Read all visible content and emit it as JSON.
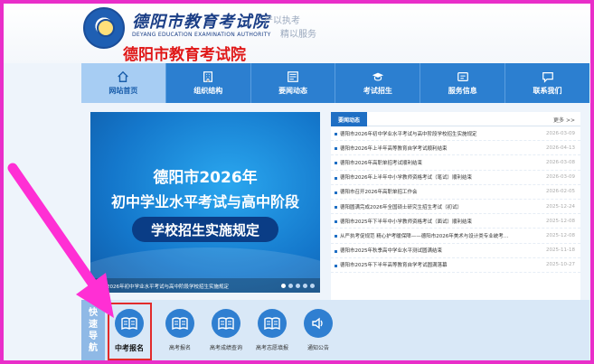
{
  "header": {
    "logo_cn": "德阳市教育考试院",
    "logo_en": "DEYANG EDUCATION EXAMINATION AUTHORITY",
    "slogan_line1": "严以执考",
    "slogan_line2": "精以服务",
    "title": "德阳市教育考试院"
  },
  "nav": [
    {
      "label": "网站首页",
      "icon": "home-icon"
    },
    {
      "label": "组织结构",
      "icon": "building-icon"
    },
    {
      "label": "要闻动态",
      "icon": "news-icon"
    },
    {
      "label": "考试招生",
      "icon": "graduation-cap-icon"
    },
    {
      "label": "服务信息",
      "icon": "service-icon"
    },
    {
      "label": "联系我们",
      "icon": "chat-icon"
    }
  ],
  "banner": {
    "line1": "德阳市2026年",
    "line2": "初中学业水平考试与高中阶段",
    "line3": "学校招生实施规定",
    "caption": "2026年初中学业水平考试与高中阶段学校招生实施规定",
    "slides": 5,
    "active_slide": 1
  },
  "news": {
    "tab": "要闻动态",
    "more": "更多 >>",
    "items": [
      {
        "title": "德阳市2026年初中学业水平考试与高中阶段学校招生实施规定",
        "date": "2026-03-09"
      },
      {
        "title": "德阳市2026年上半年高等教育自学考试顺利结束",
        "date": "2026-04-13"
      },
      {
        "title": "德阳市2026年高职单招考试顺利结束",
        "date": "2026-03-08"
      },
      {
        "title": "德阳市2026年上半年中小学教师资格考试（笔试）顺利结束",
        "date": "2026-03-09"
      },
      {
        "title": "德阳市召开2026年高职单招工作会",
        "date": "2026-02-05"
      },
      {
        "title": "德阳圆满完成2026年全国硕士研究生招生考试（初试）",
        "date": "2025-12-24"
      },
      {
        "title": "德阳市2025年下半年中小学教师资格考试（面试）顺利结束",
        "date": "2025-12-08"
      },
      {
        "title": "从严执考促规范 精心护考暖保障——德阳市2026年美术与设计类专业统考…",
        "date": "2025-12-08"
      },
      {
        "title": "德阳市2025年秋季高中学业水平测试圆满结束",
        "date": "2025-11-18"
      },
      {
        "title": "德阳市2025年下半年高等教育自学考试圆满落幕",
        "date": "2025-10-27"
      }
    ]
  },
  "quick_nav": {
    "label": "快速导航",
    "items": [
      {
        "label": "中考报名",
        "icon": "book-icon",
        "highlighted": true
      },
      {
        "label": "高考报名",
        "icon": "book-icon",
        "highlighted": false
      },
      {
        "label": "高考成绩查询",
        "icon": "book-icon",
        "highlighted": false
      },
      {
        "label": "高考志愿填报",
        "icon": "book-icon",
        "highlighted": false
      },
      {
        "label": "通知公告",
        "icon": "speaker-icon",
        "highlighted": false
      }
    ]
  },
  "colors": {
    "border": "#e92ec9",
    "nav": "#2c7fd0",
    "nav_active": "#a7cdf3",
    "highlight_box": "#e22b2b",
    "title_red": "#e01818",
    "arrow": "#ff2fd4"
  }
}
